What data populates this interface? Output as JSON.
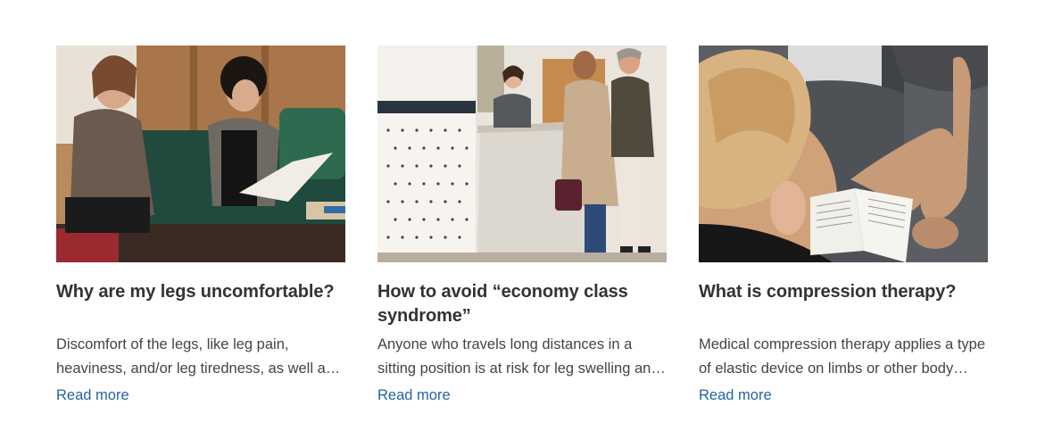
{
  "articles": [
    {
      "image_icon": "photo-women-on-sofa",
      "title": "Why are my legs uncomfortable?",
      "excerpt": "Discomfort of the legs, like leg pain, heaviness, and/or leg tiredness, as well as other symptoms",
      "link_label": "Read more"
    },
    {
      "image_icon": "photo-hotel-reception",
      "title": "How to avoid “economy class syndrome”",
      "excerpt": "Anyone who travels long distances in a sitting position is at risk for leg swelling and discomfort",
      "link_label": "Read more"
    },
    {
      "image_icon": "photo-woman-reading-armchair",
      "title": "What is compression therapy?",
      "excerpt": "Medical compression therapy applies a type of elastic device on limbs or other body parts",
      "link_label": "Read more"
    }
  ],
  "colors": {
    "title": "#333333",
    "body": "#444444",
    "link": "#2563a6"
  }
}
